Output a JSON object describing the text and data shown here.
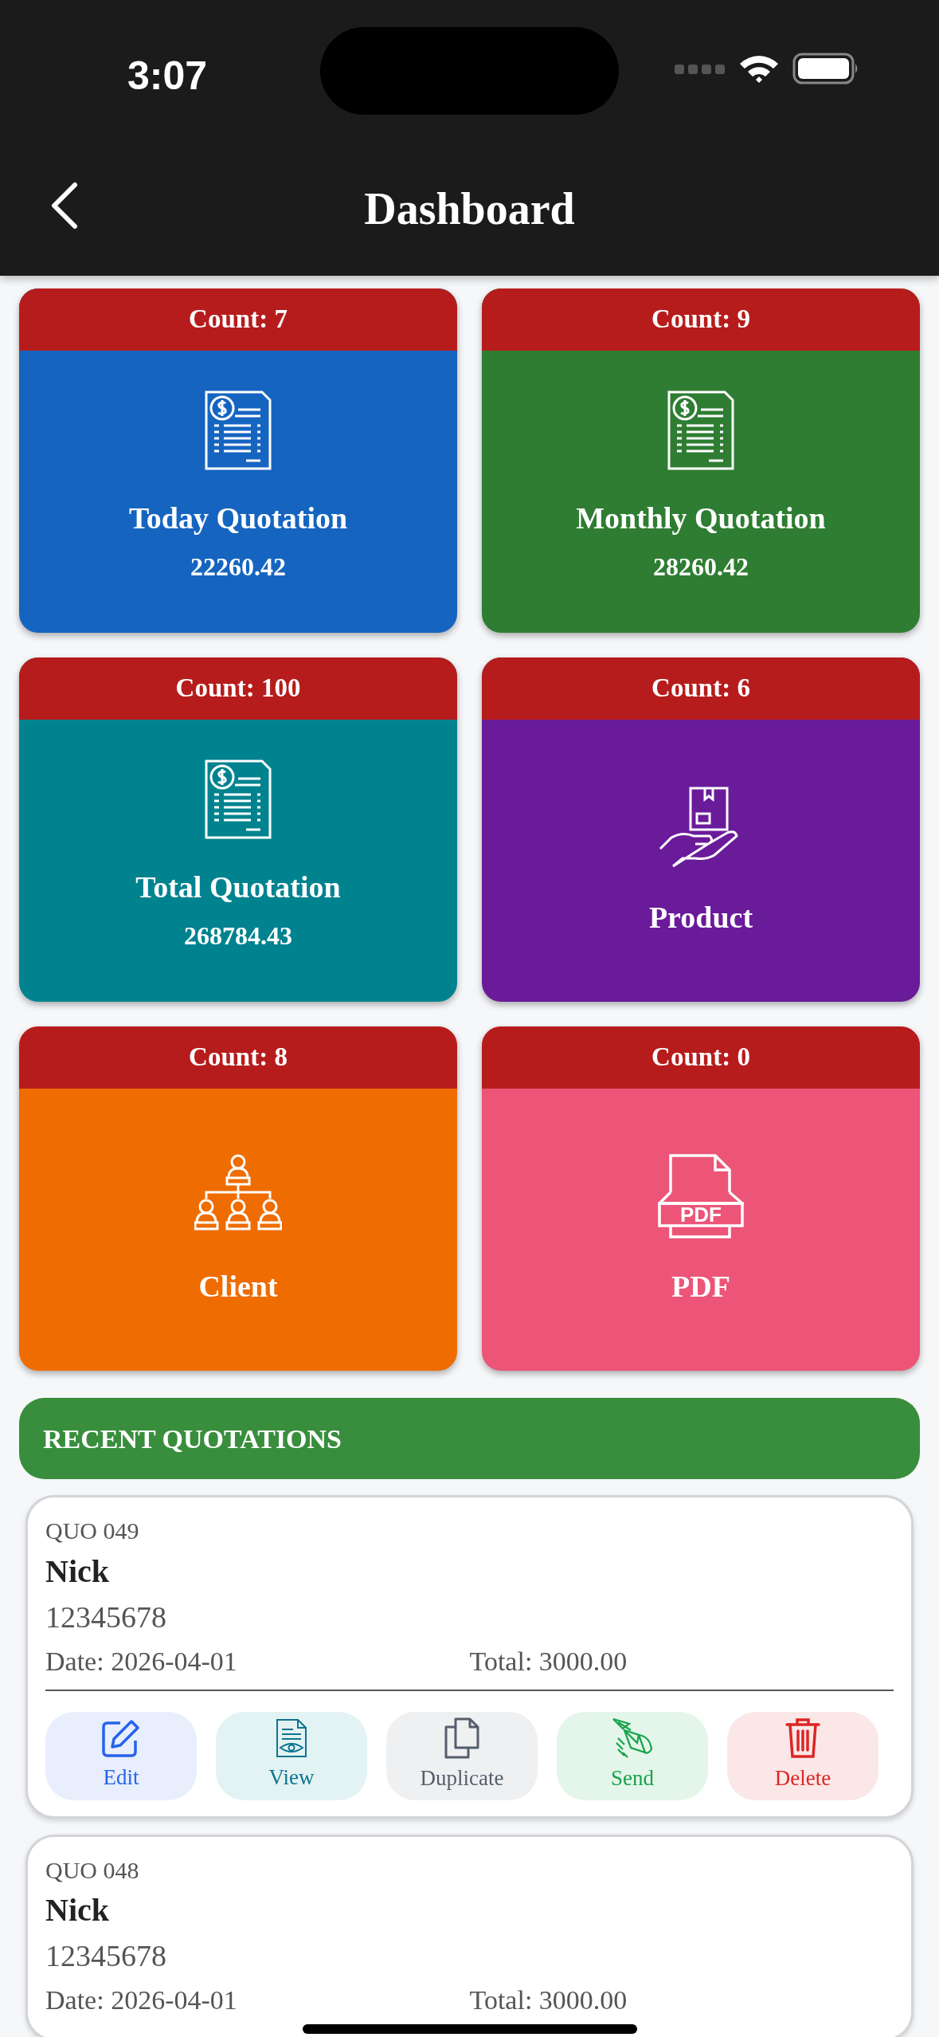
{
  "status_bar": {
    "time": "3:07"
  },
  "header": {
    "title": "Dashboard"
  },
  "tiles": [
    {
      "count": "Count: 7",
      "title": "Today Quotation",
      "amount": "22260.42",
      "color": "#1565c0",
      "kind": "invoice"
    },
    {
      "count": "Count: 9",
      "title": "Monthly Quotation",
      "amount": "28260.42",
      "color": "#2e7d32",
      "kind": "invoice"
    },
    {
      "count": "Count: 100",
      "title": "Total Quotation",
      "amount": "268784.43",
      "color": "#00838f",
      "kind": "invoice"
    },
    {
      "count": "Count: 6",
      "title": "Product",
      "color": "#6a1b9a",
      "kind": "product"
    },
    {
      "count": "Count: 8",
      "title": "Client",
      "color": "#ef6c00",
      "kind": "client"
    },
    {
      "count": "Count: 0",
      "title": "PDF",
      "color": "#ec5578",
      "kind": "pdf",
      "icon_label": "PDF"
    }
  ],
  "recent": {
    "title": "RECENT QUOTATIONS"
  },
  "quotations": [
    {
      "number": "QUO 049",
      "client": "Nick",
      "phone": "12345678",
      "date": "Date: 2026-04-01",
      "total": "Total: 3000.00",
      "actions": [
        {
          "label": "Edit",
          "kind": "edit"
        },
        {
          "label": "View",
          "kind": "view"
        },
        {
          "label": "Duplicate",
          "kind": "duplicate"
        },
        {
          "label": "Send",
          "kind": "send"
        },
        {
          "label": "Delete",
          "kind": "delete"
        }
      ]
    },
    {
      "number": "QUO 048",
      "client": "Nick",
      "phone": "12345678",
      "date": "Date: 2026-04-01",
      "total": "Total: 3000.00"
    }
  ]
}
